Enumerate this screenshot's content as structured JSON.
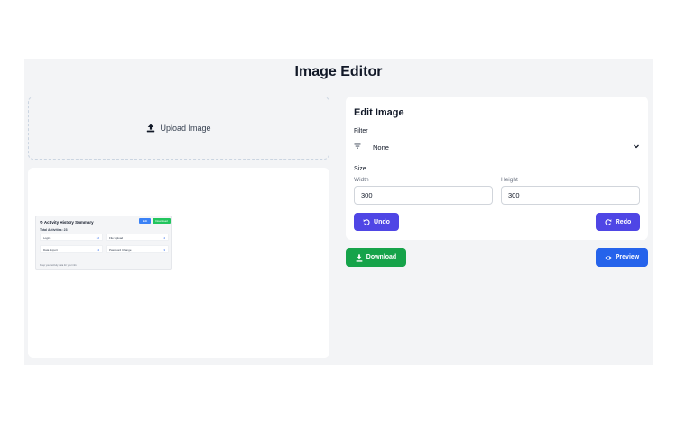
{
  "app": {
    "title": "Image Editor"
  },
  "upload": {
    "label": "Upload Image",
    "icon": "upload-icon"
  },
  "preview_thumbnail": {
    "title": "Activity History Summary",
    "button_a": "Edit",
    "button_b": "Download",
    "total": "Total Activities: 23",
    "rows": [
      {
        "label": "Login",
        "value": "12"
      },
      {
        "label": "File Upload",
        "value": "4"
      },
      {
        "label": "Data Export",
        "value": "4"
      },
      {
        "label": "Password Change",
        "value": "3"
      }
    ],
    "footer": "Keep your activity data for your info"
  },
  "edit": {
    "heading": "Edit Image",
    "filter_label": "Filter",
    "filter_value": "None",
    "size_label": "Size",
    "width_label": "Width",
    "height_label": "Height",
    "width_value": "300",
    "height_value": "300",
    "undo_label": "Undo",
    "redo_label": "Redo"
  },
  "actions": {
    "download_label": "Download",
    "preview_label": "Preview"
  },
  "colors": {
    "indigo": "#4f46e5",
    "green": "#16a34a",
    "blue": "#2563eb",
    "panel_bg": "#f3f4f6"
  }
}
